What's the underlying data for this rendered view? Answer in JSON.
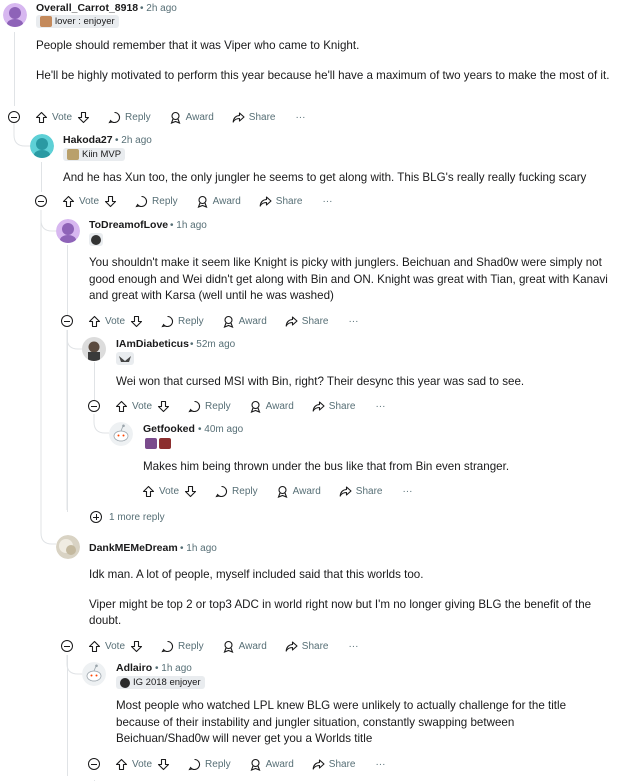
{
  "actions": {
    "vote": "Vote",
    "reply": "Reply",
    "award": "Award",
    "share": "Share",
    "more": "···"
  },
  "comments": [
    {
      "username": "Overall_Carrot_8918",
      "time": "• 2h ago",
      "flair": "lover : enjoyer",
      "paragraphs": [
        "People should remember that it was Viper who came to Knight.",
        "He'll be highly motivated to perform this year because he'll have a maximum of two years to make the most of it."
      ]
    },
    {
      "username": "Hakoda27",
      "time": "• 2h ago",
      "flair": "Kiin MVP",
      "paragraphs": [
        "And he has Xun too, the only jungler he seems to get along with. This BLG's really really fucking scary"
      ]
    },
    {
      "username": "ToDreamofLove",
      "time": "• 1h ago",
      "flair": "",
      "paragraphs": [
        "You shouldn't make it seem like Knight is picky with junglers. Beichuan and Shad0w were simply not good enough and Wei didn't get along with Bin and ON. Knight was great with Tian, great with Kanavi and great with Karsa (well until he was washed)"
      ]
    },
    {
      "username": "IAmDiabeticus",
      "time": "• 52m ago",
      "flair": "",
      "paragraphs": [
        "Wei won that cursed MSI with Bin, right? Their desync this year was sad to see."
      ]
    },
    {
      "username": "Getfooked",
      "time": "• 40m ago",
      "flair": "",
      "paragraphs": [
        "Makes him being thrown under the bus like that from Bin even stranger."
      ]
    },
    {
      "username": "DankMEMeDream",
      "time": "• 1h ago",
      "flair": "",
      "paragraphs": [
        "Idk man. A lot of people, myself included said that this worlds too.",
        "Viper might be top 2 or top3 ADC in world right now but I'm no longer giving BLG the benefit of the doubt."
      ]
    },
    {
      "username": "Adlairo",
      "time": "• 1h ago",
      "flair": "IG 2018 enjoyer",
      "paragraphs": [
        "Most people who watched LPL knew BLG were unlikely to actually challenge for the title because of their instability and jungler situation, constantly swapping between Beichuan/Shad0w will never get you a Worlds title"
      ]
    }
  ],
  "more_replies": "1 more reply",
  "colors": {
    "meta": "#576f76",
    "thread": "#e0e3e6",
    "flair_bg": "#e9ecef"
  }
}
